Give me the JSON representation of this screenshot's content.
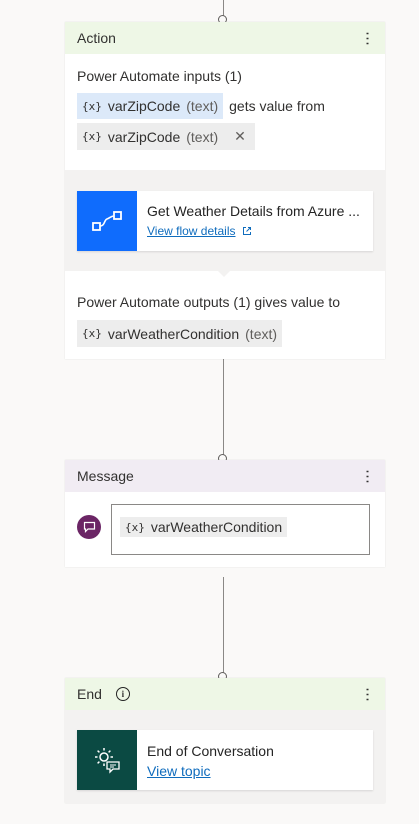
{
  "action": {
    "header": "Action",
    "inputs_label": "Power Automate inputs (1)",
    "input_var_name": "varZipCode",
    "input_var_type": "(text)",
    "gets_value_from": "gets value from",
    "source_var_name": "varZipCode",
    "source_var_type": "(text)",
    "flow_name": "Get Weather Details from Azure ...",
    "flow_link": "View flow details",
    "outputs_label": "Power Automate outputs (1) gives value to",
    "output_var_name": "varWeatherCondition",
    "output_var_type": "(text)"
  },
  "message": {
    "header": "Message",
    "var_name": "varWeatherCondition"
  },
  "end": {
    "header": "End",
    "title": "End of Conversation",
    "link": "View topic"
  },
  "var_glyph": "{x}",
  "colors": {
    "flow_tile": "#0f6cfd",
    "end_tile": "#0b4a43",
    "message_avatar": "#6b2565",
    "link": "#0f6cbd",
    "header_green": "#eef7e6",
    "header_purple": "#f1ecf3"
  }
}
